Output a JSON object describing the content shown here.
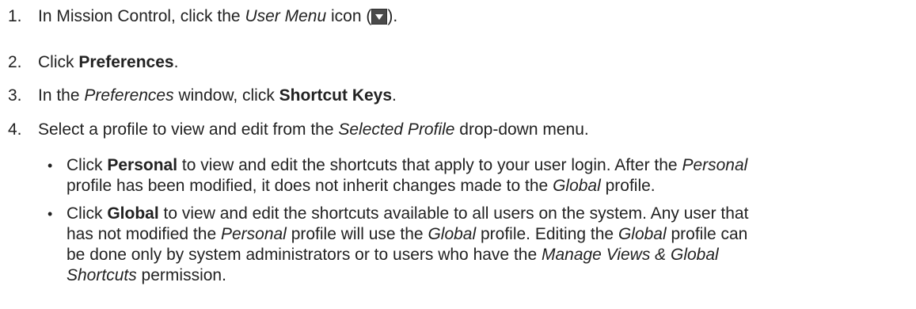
{
  "steps": [
    {
      "number": "1.",
      "parts": [
        "In Mission Control, click the ",
        "User Menu",
        " icon (",
        ")."
      ],
      "icon": "user-menu-dropdown-icon"
    },
    {
      "number": "2.",
      "parts": [
        "Click ",
        "Preferences",
        "."
      ]
    },
    {
      "number": "3.",
      "parts": [
        "In the ",
        "Preferences",
        " window, click ",
        "Shortcut Keys",
        "."
      ]
    },
    {
      "number": "4.",
      "parts": [
        "Select a profile to view and edit from the ",
        "Selected Profile",
        " drop-down menu."
      ]
    }
  ],
  "bullets": [
    {
      "marker": "•",
      "line1": [
        "Click ",
        "Personal",
        " to view and edit the shortcuts that apply to your user login. After the ",
        "Personal"
      ],
      "line2": [
        "profile has been modified, it does not inherit changes made to the ",
        "Global",
        " profile."
      ]
    },
    {
      "marker": "•",
      "line1": [
        "Click ",
        "Global",
        " to view and edit the shortcuts available to all users on the system. Any user that"
      ],
      "line2": [
        "has not modified the ",
        "Personal",
        " profile will use the ",
        "Global",
        " profile. Editing the ",
        "Global",
        " profile can"
      ],
      "line3": [
        "be done only by system administrators or to users who have the ",
        "Manage Views & Global"
      ],
      "line4": [
        "Shortcuts",
        " permission."
      ]
    }
  ],
  "colors": {
    "text": "#222222",
    "icon_bg": "#4a4a4a",
    "icon_arrow": "#ffffff"
  }
}
